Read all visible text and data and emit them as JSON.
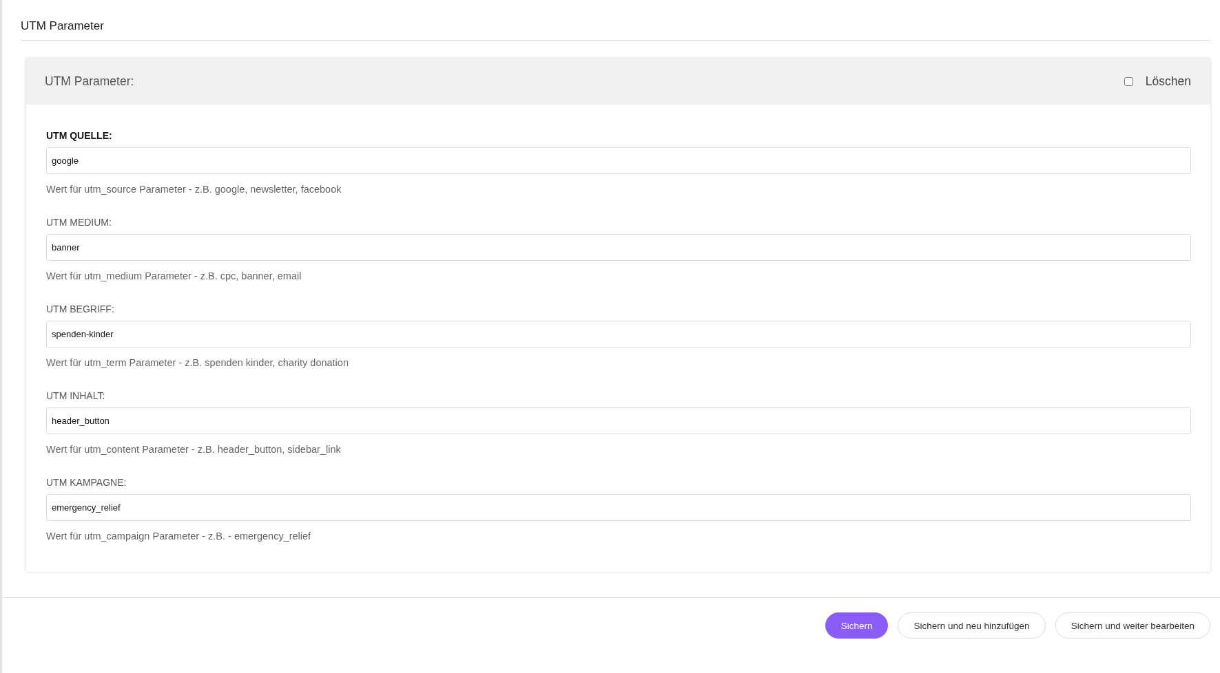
{
  "page_title": "UTM Parameter",
  "panel": {
    "title": "UTM Parameter:",
    "delete": {
      "label": "Löschen",
      "checked": false
    }
  },
  "fields": [
    {
      "label": "UTM QUELLE:",
      "required": true,
      "value": "google",
      "help": "Wert für utm_source Parameter - z.B. google, newsletter, facebook"
    },
    {
      "label": "UTM MEDIUM:",
      "required": false,
      "value": "banner",
      "help": "Wert für utm_medium Parameter - z.B. cpc, banner, email"
    },
    {
      "label": "UTM BEGRIFF:",
      "required": false,
      "value": "spenden-kinder",
      "help": "Wert für utm_term Parameter - z.B. spenden kinder, charity donation"
    },
    {
      "label": "UTM INHALT:",
      "required": false,
      "value": "header_button",
      "help": "Wert für utm_content Parameter - z.B. header_button, sidebar_link"
    },
    {
      "label": "UTM KAMPAGNE:",
      "required": false,
      "value": "emergency_relief",
      "help": "Wert für utm_campaign Parameter - z.B. - emergency_relief"
    }
  ],
  "buttons": [
    {
      "label": "Sichern",
      "kind": "primary"
    },
    {
      "label": "Sichern und neu hinzufügen",
      "kind": "default"
    },
    {
      "label": "Sichern und weiter bearbeiten",
      "kind": "default"
    }
  ]
}
